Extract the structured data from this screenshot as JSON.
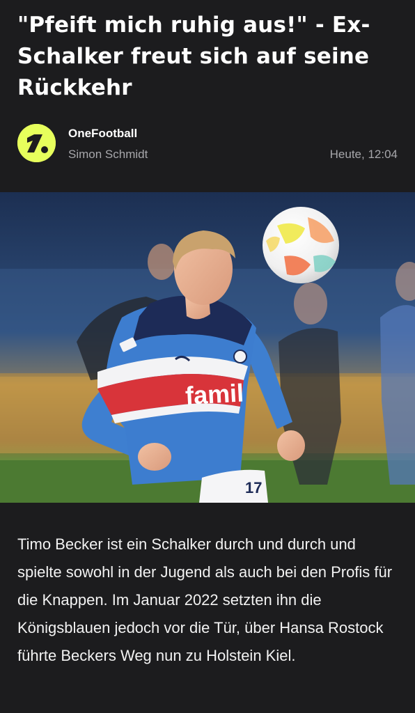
{
  "article": {
    "headline": "\"Pfeift mich ruhig aus!\" - Ex-Schalker freut sich auf seine Rückkehr",
    "source": {
      "name": "OneFootball",
      "logo_icon": "onefootball-logo-icon",
      "logo_color": "#e7ff5c"
    },
    "author": "Simon Schmidt",
    "published": "Heute, 12:04",
    "image": {
      "jersey_sponsor": "famil",
      "jersey_number": "17"
    },
    "body": "Timo Becker ist ein Schalker durch und durch und spielte sowohl in der Jugend als auch bei den Profis für die Knappen. Im Januar 2022 setzten ihn die Königsblauen jedoch vor die Tür, über Hansa Rostock führte Beckers Weg nun zu Holstein Kiel."
  },
  "colors": {
    "background": "#1c1c1e",
    "text_primary": "#ffffff",
    "text_secondary": "#a7a7ab"
  }
}
